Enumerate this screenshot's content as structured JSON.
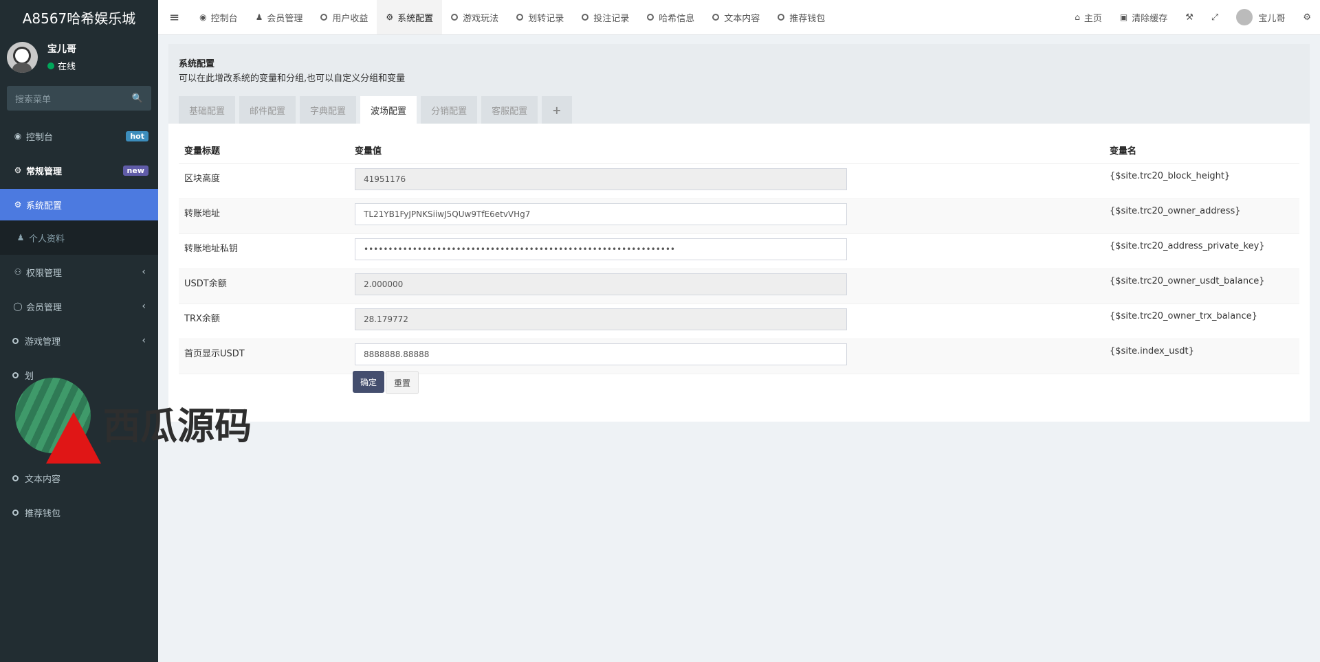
{
  "app": {
    "title": "A8567哈希娱乐城"
  },
  "user": {
    "name": "宝儿哥",
    "status": "在线"
  },
  "sidebar": {
    "search_placeholder": "搜索菜单",
    "items": [
      {
        "label": "控制台",
        "badge": "hot",
        "icon": "dashboard-icon"
      },
      {
        "label": "常规管理",
        "badge": "new",
        "icon": "cogs-icon"
      },
      {
        "label": "系统配置",
        "icon": "gear-icon"
      },
      {
        "label": "个人资料",
        "icon": "user-icon"
      },
      {
        "label": "权限管理",
        "icon": "group-icon"
      },
      {
        "label": "会员管理",
        "icon": "user-circle-icon"
      },
      {
        "label": "游戏管理",
        "icon": "circle-icon"
      },
      {
        "label": "划",
        "icon": "circle-icon"
      },
      {
        "label": "文本内容",
        "icon": "circle-icon"
      },
      {
        "label": "推荐钱包",
        "icon": "circle-icon"
      }
    ]
  },
  "topbar": {
    "tabs": [
      "控制台",
      "会员管理",
      "用户收益",
      "系统配置",
      "游戏玩法",
      "划转记录",
      "投注记录",
      "哈希信息",
      "文本内容",
      "推荐钱包"
    ],
    "home": "主页",
    "clear_cache": "清除缓存",
    "user": "宝儿哥"
  },
  "page": {
    "title": "系统配置",
    "description": "可以在此增改系统的变量和分组,也可以自定义分组和变量",
    "tabs": [
      "基础配置",
      "邮件配置",
      "字典配置",
      "波场配置",
      "分销配置",
      "客服配置",
      "+"
    ]
  },
  "table": {
    "headers": [
      "变量标题",
      "变量值",
      "变量名"
    ],
    "rows": [
      {
        "title": "区块高度",
        "value": "41951176",
        "name": "{$site.trc20_block_height}"
      },
      {
        "title": "转账地址",
        "value": "TL21YB1FyJPNKSiiwJ5QUw9TfE6etvVHg7",
        "name": "{$site.trc20_owner_address}"
      },
      {
        "title": "转账地址私钥",
        "value": "••••••••••••••••••••••••••••••••••••••••••••••••••••••••••••••••",
        "name": "{$site.trc20_address_private_key}"
      },
      {
        "title": "USDT余额",
        "value": "2.000000",
        "name": "{$site.trc20_owner_usdt_balance}"
      },
      {
        "title": "TRX余额",
        "value": "28.179772",
        "name": "{$site.trc20_owner_trx_balance}"
      },
      {
        "title": "首页显示USDT",
        "value": "8888888.88888",
        "name": "{$site.index_usdt}"
      }
    ]
  },
  "buttons": {
    "confirm": "确定",
    "reset": "重置"
  },
  "watermark": {
    "text": "西瓜源码"
  },
  "colors": {
    "sidebar_bg": "#222d32",
    "active_item": "#4c7ae0",
    "primary_button": "#444e6e"
  }
}
